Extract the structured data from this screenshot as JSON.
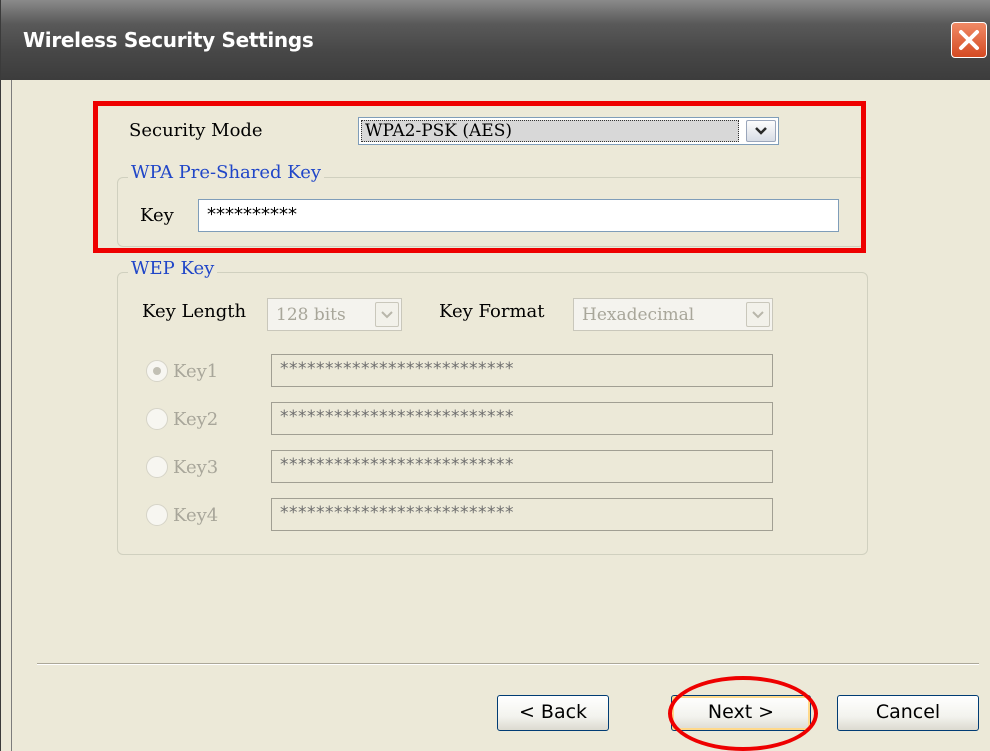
{
  "window": {
    "title": "Wireless Security Settings",
    "close_icon": "close-icon"
  },
  "security": {
    "mode_label": "Security Mode",
    "mode_value": "WPA2-PSK (AES)"
  },
  "wpa": {
    "legend": "WPA Pre-Shared Key",
    "key_label": "Key",
    "key_value": "**********"
  },
  "wep": {
    "legend": "WEP Key",
    "key_length_label": "Key Length",
    "key_length_value": "128 bits",
    "key_format_label": "Key Format",
    "key_format_value": "Hexadecimal",
    "keys": [
      {
        "label": "Key1",
        "value": "**************************",
        "selected": true
      },
      {
        "label": "Key2",
        "value": "**************************",
        "selected": false
      },
      {
        "label": "Key3",
        "value": "**************************",
        "selected": false
      },
      {
        "label": "Key4",
        "value": "**************************",
        "selected": false
      }
    ]
  },
  "buttons": {
    "back": "< Back",
    "next": "Next >",
    "cancel": "Cancel"
  },
  "colors": {
    "annotation": "#ee0000",
    "group_legend": "#2046c8",
    "titlebar": "#474747"
  }
}
